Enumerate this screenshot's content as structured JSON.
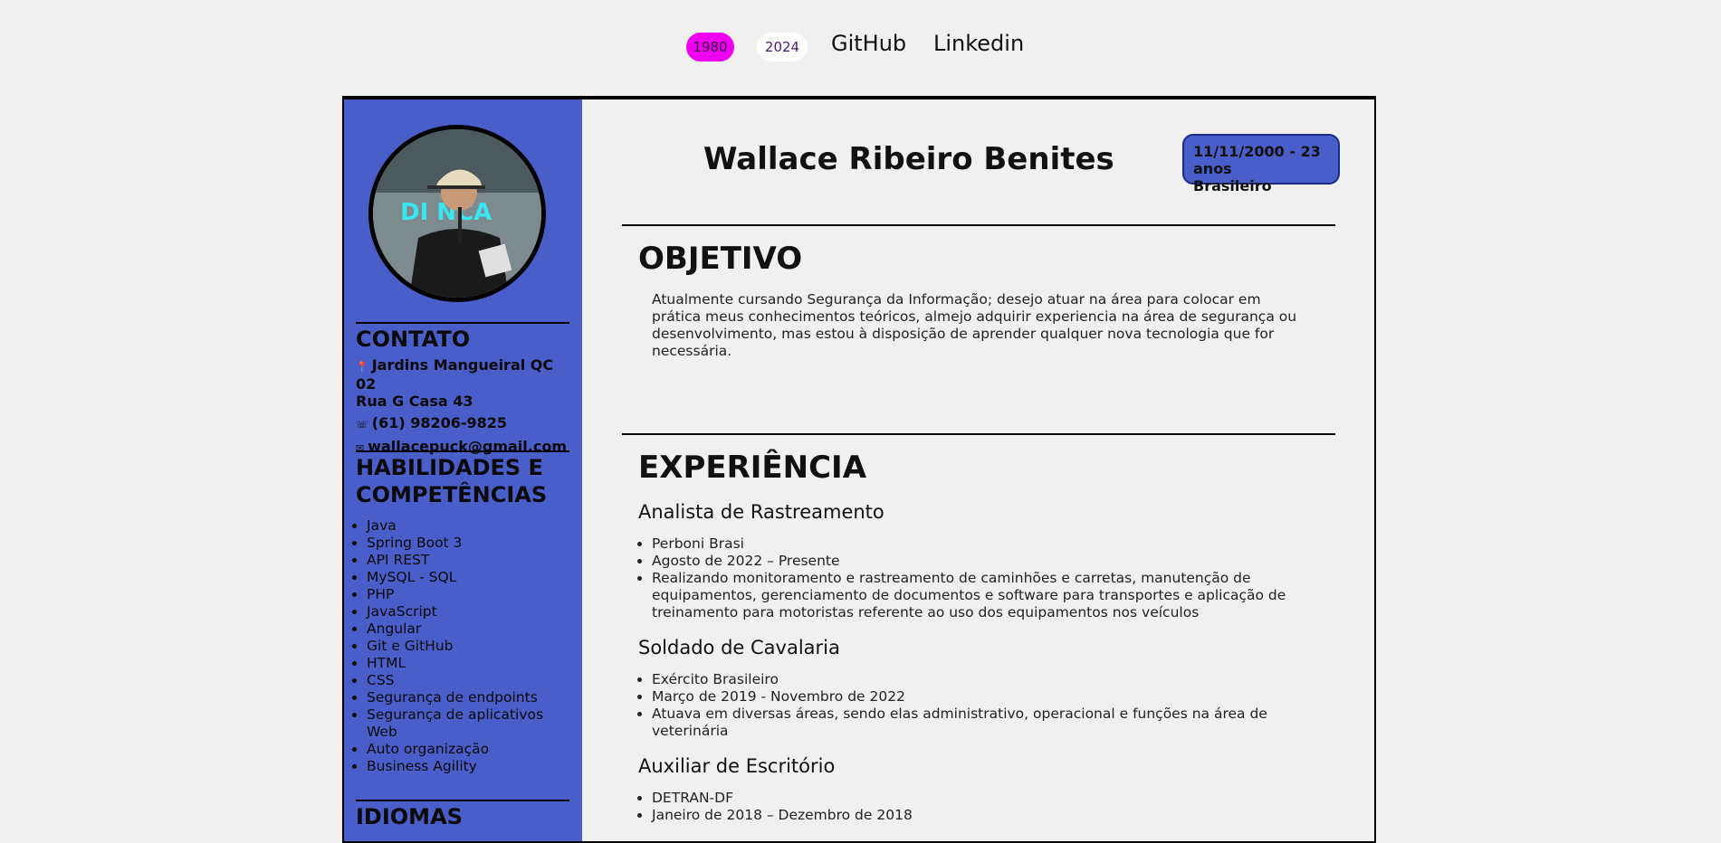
{
  "nav": {
    "pill_1980": "1980",
    "pill_2024": "2024",
    "github": "GitHub",
    "linkedin": "Linkedin"
  },
  "sidebar": {
    "contact_heading": "CONTATO",
    "address_line1": "Jardins Mangueiral QC 02",
    "address_line2": "Rua G Casa 43",
    "phone": "(61) 98206-9825",
    "email": "wallacepuck@gmail.com",
    "skills_heading_1": "HABILIDADES E",
    "skills_heading_2": "COMPETÊNCIAS",
    "skills": [
      "Java",
      "Spring Boot 3",
      "API REST",
      "MySQL - SQL",
      "PHP",
      "JavaScript",
      "Angular",
      "Git e GitHub",
      "HTML",
      "CSS",
      "Segurança de endpoints",
      "Segurança de aplicativos Web",
      "Auto organização",
      "Business Agility"
    ],
    "languages_heading": "IDIOMAS"
  },
  "main": {
    "name": "Wallace Ribeiro Benites",
    "badge_line1": "11/11/2000 - 23 anos",
    "badge_line2": "Brasileiro",
    "objective_heading": "OBJETIVO",
    "objective_text": "Atualmente cursando Segurança da Informação; desejo atuar na área para colocar em prática meus conhecimentos teóricos, almejo adquirir experiencia na área de segurança ou desenvolvimento, mas estou à disposição de aprender qualquer nova tecnologia que for necessária.",
    "experience_heading": "EXPERIÊNCIA",
    "jobs": [
      {
        "title": "Analista de Rastreamento",
        "items": [
          "Perboni Brasi",
          "Agosto de 2022 – Presente",
          "Realizando monitoramento e rastreamento de caminhões e carretas, manutenção de equipamentos, gerenciamento de documentos e software para transportes e aplicação de treinamento para motoristas referente ao uso dos equipamentos nos veículos"
        ]
      },
      {
        "title": "Soldado de Cavalaria",
        "items": [
          "Exército Brasileiro",
          "Março de 2019 - Novembro de 2022",
          "Atuava em diversas áreas, sendo elas administrativo, operacional e funções na área de veterinária"
        ]
      },
      {
        "title": "Auxiliar de Escritório",
        "items": [
          "DETRAN-DF",
          "Janeiro de 2018 – Dezembro de 2018"
        ]
      }
    ]
  },
  "colors": {
    "sidebar_bg": "#4a5ec9",
    "pill_1980_bg": "#f000f0",
    "page_bg": "#f0f0f0"
  },
  "icons": {
    "location": "location-pin-icon",
    "phone": "whatsapp-icon",
    "email": "envelope-icon"
  }
}
